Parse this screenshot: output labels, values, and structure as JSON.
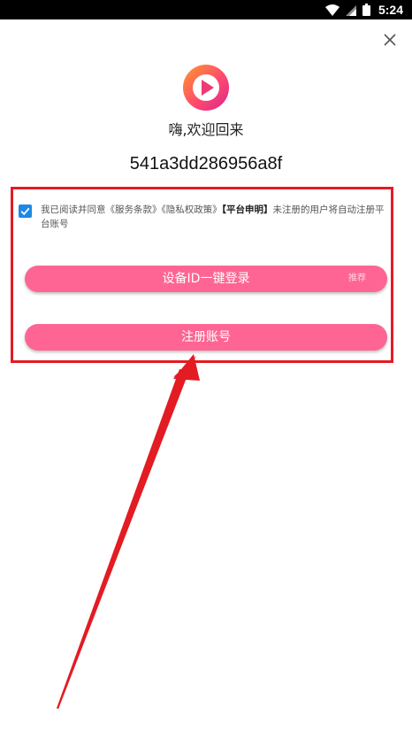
{
  "status_bar": {
    "time": "5:24"
  },
  "welcome_text": "嗨,欢迎回来",
  "device_id": "541a3dd286956a8f",
  "agreement": {
    "text_prefix": "我已阅读并同意",
    "terms_link": "《服务条款》",
    "privacy_link": "《隐私权政策》",
    "platform_statement": "【平台申明】",
    "text_suffix": "未注册的用户将自动注册平台账号",
    "checked": true
  },
  "buttons": {
    "device_login": "设备ID一键登录",
    "recommend_tag": "推荐",
    "register": "注册账号"
  },
  "colors": {
    "accent_pink": "#fe6594",
    "highlight_red": "#e31b23",
    "checkbox_blue": "#1e88e5"
  },
  "icons": [
    "wifi-icon",
    "signal-icon",
    "battery-icon",
    "close-icon",
    "app-logo-play-icon",
    "checkbox-checked-icon",
    "annotation-arrow"
  ]
}
